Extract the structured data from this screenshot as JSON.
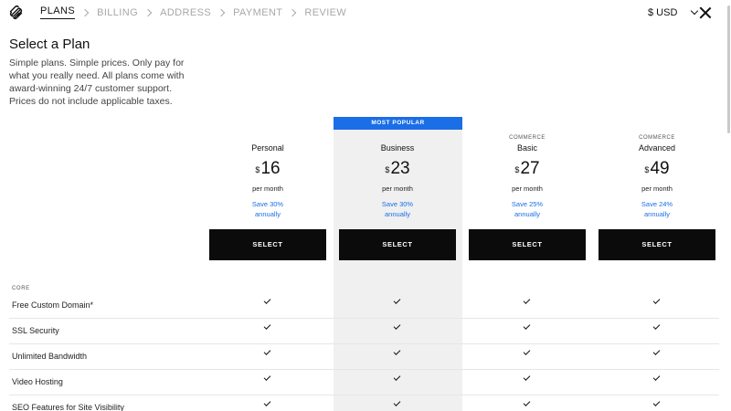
{
  "header": {
    "steps": [
      "PLANS",
      "BILLING",
      "ADDRESS",
      "PAYMENT",
      "REVIEW"
    ],
    "currency": "$ USD"
  },
  "intro": {
    "title": "Select a Plan",
    "subtitle": "Simple plans. Simple prices. Only pay for what you really need. All plans come with award-winning 24/7 customer support. Prices do not include applicable taxes."
  },
  "popular_tag": "MOST POPULAR",
  "plans": [
    {
      "eyebrow": "",
      "name": "Personal",
      "currency_symbol": "$",
      "price": "16",
      "period": "per month",
      "save_line1": "Save 30%",
      "save_line2": "annually",
      "cta": "SELECT"
    },
    {
      "eyebrow": "",
      "name": "Business",
      "currency_symbol": "$",
      "price": "23",
      "period": "per month",
      "save_line1": "Save 30%",
      "save_line2": "annually",
      "cta": "SELECT"
    },
    {
      "eyebrow": "COMMERCE",
      "name": "Basic",
      "currency_symbol": "$",
      "price": "27",
      "period": "per month",
      "save_line1": "Save 25%",
      "save_line2": "annually",
      "cta": "SELECT"
    },
    {
      "eyebrow": "COMMERCE",
      "name": "Advanced",
      "currency_symbol": "$",
      "price": "49",
      "period": "per month",
      "save_line1": "Save 24%",
      "save_line2": "annually",
      "cta": "SELECT"
    }
  ],
  "features": {
    "section_label": "CORE",
    "rows": [
      {
        "name": "Free Custom Domain*",
        "included": [
          true,
          true,
          true,
          true
        ]
      },
      {
        "name": "SSL Security",
        "included": [
          true,
          true,
          true,
          true
        ]
      },
      {
        "name": "Unlimited Bandwidth",
        "included": [
          true,
          true,
          true,
          true
        ]
      },
      {
        "name": "Video Hosting",
        "included": [
          true,
          true,
          true,
          true
        ]
      },
      {
        "name": "SEO Features for Site Visibility",
        "included": [
          true,
          true,
          true,
          true
        ]
      }
    ]
  },
  "colors": {
    "accent": "#1a6ee6",
    "button": "#0b0b0b",
    "popular_bg": "#f0f0f0"
  }
}
